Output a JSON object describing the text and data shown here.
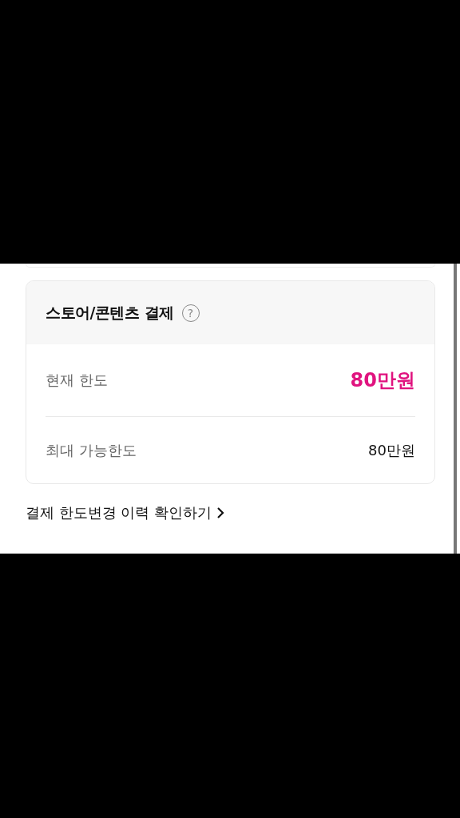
{
  "card": {
    "title": "스토어/콘텐츠 결제",
    "help_icon": "?",
    "rows": [
      {
        "label": "현재 한도",
        "value": "80만원",
        "kind": "highlight"
      },
      {
        "label": "최대 가능한도",
        "value": "80만원",
        "kind": "plain"
      }
    ]
  },
  "history_link": {
    "label": "결제 한도변경 이력 확인하기"
  }
}
